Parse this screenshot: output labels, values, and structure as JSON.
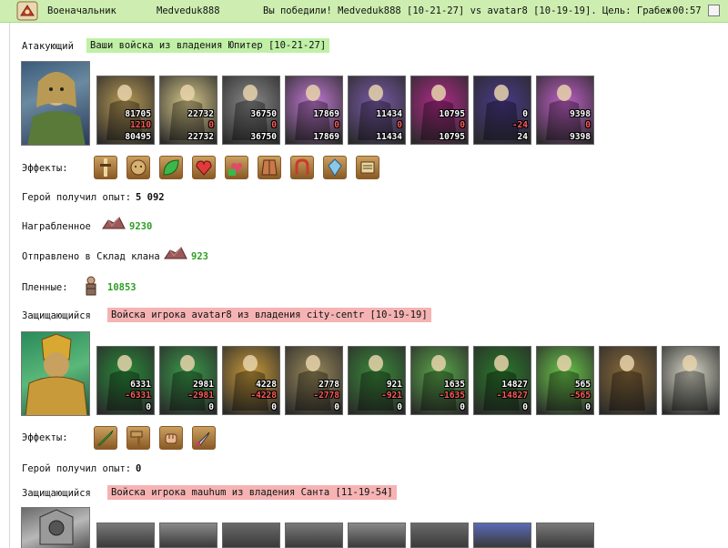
{
  "header": {
    "title": "Военачальник",
    "user": "Medveduk888",
    "message": "Вы победили! Medveduk888 [10-21-27] vs avatar8 [10-19-19]. Цель: Грабеж",
    "time": "00:57"
  },
  "attacker": {
    "label": "Атакующий",
    "tag": "Ваши войска из владения Юпитер [10-21-27]",
    "units": [
      {
        "a": "81705",
        "b": "1210",
        "c": "80495",
        "color": "#b89a55"
      },
      {
        "a": "22732",
        "b": "0",
        "c": "22732",
        "color": "#d8c98a"
      },
      {
        "a": "36750",
        "b": "0",
        "c": "36750",
        "color": "#8a8a8a"
      },
      {
        "a": "17869",
        "b": "0",
        "c": "17869",
        "color": "#c47ad6"
      },
      {
        "a": "11434",
        "b": "0",
        "c": "11434",
        "color": "#7a5aa8"
      },
      {
        "a": "10795",
        "b": "0",
        "c": "10795",
        "color": "#b02a8a"
      },
      {
        "a": "0",
        "b": "-24",
        "c": "24",
        "color": "#4a3a8a"
      },
      {
        "a": "9398",
        "b": "0",
        "c": "9398",
        "color": "#c060c8"
      }
    ],
    "effects_label": "Эффекты:",
    "effects": [
      "sword-hilt-icon",
      "lion-head-icon",
      "green-leaf-icon",
      "heart-icon",
      "gift-heart-icon",
      "armor-icon",
      "horseshoe-icon",
      "crystal-icon",
      "scroll-icon"
    ],
    "exp_label": "Герой получил опыт:",
    "exp_value": "5 092",
    "loot_label": "Награбленное",
    "loot_value": "9230",
    "clan_label": "Отправлено в Склад клана",
    "clan_value": "923",
    "captives_label": "Пленные:",
    "captives_value": "10853"
  },
  "defender1": {
    "label": "Защищающийся",
    "tag": "Войска игрока avatar8 из владения city-centr [10-19-19]",
    "units": [
      {
        "a": "6331",
        "b": "-6331",
        "c": "0",
        "color": "#2a8a3a"
      },
      {
        "a": "2981",
        "b": "-2981",
        "c": "0",
        "color": "#3a9a4a"
      },
      {
        "a": "4228",
        "b": "-4228",
        "c": "0",
        "color": "#c89a3a"
      },
      {
        "a": "2778",
        "b": "-2778",
        "c": "0",
        "color": "#9a8a5a"
      },
      {
        "a": "921",
        "b": "-921",
        "c": "0",
        "color": "#3a8a3a"
      },
      {
        "a": "1635",
        "b": "-1635",
        "c": "0",
        "color": "#5aa84a"
      },
      {
        "a": "14827",
        "b": "-14827",
        "c": "0",
        "color": "#2a7a2a"
      },
      {
        "a": "565",
        "b": "-565",
        "c": "0",
        "color": "#6ac84a"
      },
      {
        "a": "",
        "b": "",
        "c": "",
        "color": "#8a6a3a"
      },
      {
        "a": "",
        "b": "",
        "c": "",
        "color": "#d8d8c8"
      }
    ],
    "effects_label": "Эффекты:",
    "effects": [
      "green-sword-icon",
      "hammer-icon",
      "fist-icon",
      "dagger-icon"
    ],
    "exp_label": "Герой получил опыт:",
    "exp_value": "0"
  },
  "defender2": {
    "label": "Защищающийся",
    "tag": "Войска игрока mauhum из владения Санта [11-19-54]"
  },
  "colors": {
    "header_bg": "#cdeeb0",
    "green_tag": "#bff0a6",
    "pink_tag": "#f5b3b3",
    "green_number": "#2d9e22",
    "loss_number": "#ff5a5a"
  }
}
